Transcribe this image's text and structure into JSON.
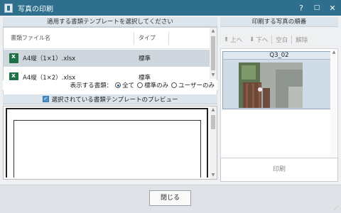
{
  "window": {
    "title": "写真の印刷",
    "help_glyph": "?",
    "maximize_glyph": "□",
    "close_glyph": "✕"
  },
  "templates": {
    "header": "適用する書類テンプレートを選択してください",
    "columns": {
      "name": "書類ファイル名",
      "type": "タイプ"
    },
    "rows": [
      {
        "name": "A4縦（1×1）.xlsx",
        "type": "標準",
        "selected": true
      },
      {
        "name": "A4縦（1×2）.xlsx",
        "type": "標準",
        "selected": false
      }
    ],
    "filter": {
      "label": "表示する書類：",
      "options": [
        {
          "label": "全て",
          "checked": true
        },
        {
          "label": "標準のみ",
          "checked": false
        },
        {
          "label": "ユーザーのみ",
          "checked": false
        }
      ]
    }
  },
  "preview": {
    "header": "選択されている書類テンプレートのプレビュー",
    "checked": true
  },
  "order": {
    "header": "印刷する写真の順番",
    "toolbar": {
      "up": "上へ",
      "down": "下へ",
      "blank": "空白",
      "remove": "解除"
    },
    "photos": [
      {
        "caption": "Q3_02"
      }
    ]
  },
  "actions": {
    "print": "印刷",
    "close": "閉じる"
  },
  "colors": {
    "titlebar": "#2d6f8d",
    "panel_header": "#dce4ec",
    "selected_row": "#cfd6de",
    "excel_green": "#1e7145"
  }
}
